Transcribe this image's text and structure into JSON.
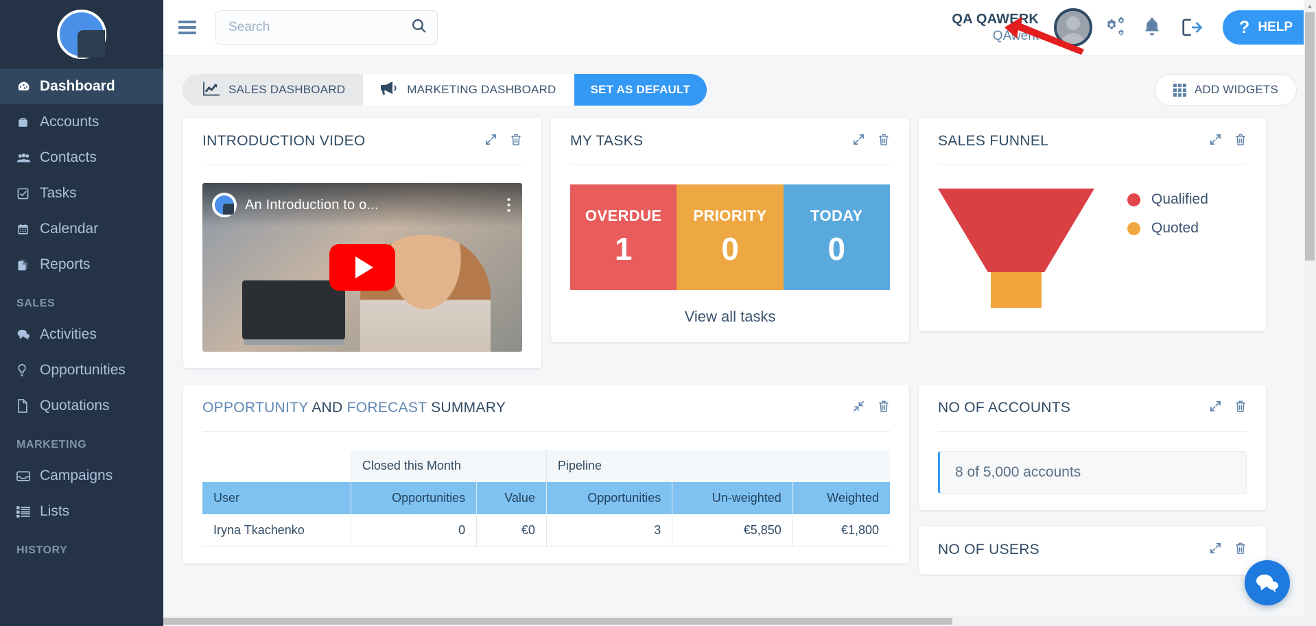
{
  "sidebar": {
    "logo_name": "app-logo",
    "items": [
      {
        "label": "Dashboard",
        "icon": "dashboard-icon",
        "active": true
      },
      {
        "label": "Accounts",
        "icon": "briefcase-icon",
        "active": false
      },
      {
        "label": "Contacts",
        "icon": "people-icon",
        "active": false
      },
      {
        "label": "Tasks",
        "icon": "check-square-icon",
        "active": false
      },
      {
        "label": "Calendar",
        "icon": "calendar-icon",
        "active": false
      },
      {
        "label": "Reports",
        "icon": "documents-icon",
        "active": false
      }
    ],
    "sections": [
      {
        "title": "SALES",
        "items": [
          {
            "label": "Activities",
            "icon": "chat-bubbles-icon"
          },
          {
            "label": "Opportunities",
            "icon": "lightbulb-icon"
          },
          {
            "label": "Quotations",
            "icon": "file-icon"
          }
        ]
      },
      {
        "title": "MARKETING",
        "items": [
          {
            "label": "Campaigns",
            "icon": "inbox-icon"
          },
          {
            "label": "Lists",
            "icon": "list-icon"
          }
        ]
      },
      {
        "title": "HISTORY",
        "items": []
      }
    ]
  },
  "topbar": {
    "menu_icon": "hamburger-icon",
    "search": {
      "value": "",
      "placeholder": "Search",
      "icon": "search-icon"
    },
    "user_name": "QA QAWERK",
    "user_org": "QAwerk",
    "avatar": "user-avatar",
    "settings_icon": "gears-icon",
    "notifications_icon": "bell-icon",
    "logout_icon": "logout-icon",
    "help_label": "HELP",
    "help_mark": "?"
  },
  "tabs": [
    {
      "label": "SALES DASHBOARD",
      "icon": "line-chart-icon",
      "state": "selected"
    },
    {
      "label": "MARKETING DASHBOARD",
      "icon": "megaphone-icon",
      "state": "normal"
    },
    {
      "label": "SET AS DEFAULT",
      "icon": "",
      "state": "primary"
    }
  ],
  "add_widgets": {
    "label": "ADD WIDGETS",
    "icon": "grid-icon"
  },
  "widgets": {
    "intro_video": {
      "title": "INTRODUCTION VIDEO",
      "video_title": "An Introduction to o...",
      "expand_icon": "expand-icon",
      "delete_icon": "trash-icon",
      "play_icon": "youtube-play-icon",
      "menu_icon": "kebab-menu-icon"
    },
    "my_tasks": {
      "title": "MY TASKS",
      "expand_icon": "expand-icon",
      "delete_icon": "trash-icon",
      "tiles": [
        {
          "label": "OVERDUE",
          "value": "1",
          "color": "#e85c5c"
        },
        {
          "label": "PRIORITY",
          "value": "0",
          "color": "#eda843"
        },
        {
          "label": "TODAY",
          "value": "0",
          "color": "#5aa9dd"
        }
      ],
      "view_all_label": "View all tasks"
    },
    "sales_funnel": {
      "title": "SALES FUNNEL",
      "expand_icon": "expand-icon",
      "delete_icon": "trash-icon",
      "legend": [
        {
          "label": "Qualified",
          "color": "#e0464b"
        },
        {
          "label": "Quoted",
          "color": "#f0a63c"
        }
      ]
    },
    "opportunity_summary": {
      "title_part1": "OPPORTUNITY",
      "title_part2": "AND",
      "title_part3": "FORECAST",
      "title_part4": "SUMMARY",
      "collapse_icon": "collapse-icon",
      "delete_icon": "trash-icon",
      "group_headers": [
        "",
        "Closed this Month",
        "Pipeline"
      ],
      "columns": [
        "User",
        "Opportunities",
        "Value",
        "Opportunities",
        "Un-weighted",
        "Weighted"
      ],
      "rows": [
        {
          "user": "Iryna Tkachenko",
          "closed_opportunities": "0",
          "closed_value": "€0",
          "pipeline_opportunities": "3",
          "unweighted": "€5,850",
          "weighted": "€1,800"
        }
      ]
    },
    "no_of_accounts": {
      "title": "NO OF ACCOUNTS",
      "expand_icon": "expand-icon",
      "delete_icon": "trash-icon",
      "stat": "8 of 5,000 accounts"
    },
    "no_of_users": {
      "title": "NO OF USERS",
      "expand_icon": "expand-icon",
      "delete_icon": "trash-icon"
    }
  },
  "chat_fab": {
    "icon": "chat-bubbles-icon"
  },
  "annotation": {
    "arrow": "red-arrow-pointer"
  },
  "colors": {
    "sidebar_bg": "#243446",
    "accent": "#3498f5",
    "danger": "#e85c5c",
    "warning": "#eda843",
    "info": "#5aa9dd",
    "funnel_top": "#da3f44",
    "funnel_stem": "#f0a63c",
    "table_header": "#7fc2f2"
  }
}
